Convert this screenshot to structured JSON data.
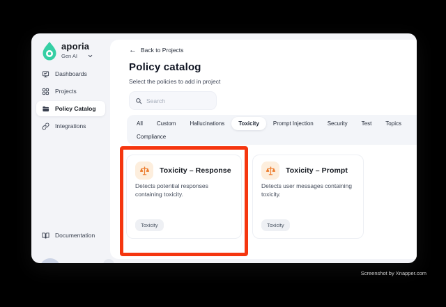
{
  "colors": {
    "accent-teal": "#35cfa4",
    "icon-orange": "#ec7c2e",
    "icon-orange-bg": "#fdeedd",
    "highlight-red": "#f5360f",
    "window-bg": "#f3f4f8"
  },
  "sidebar": {
    "logo": {
      "brand": "aporia",
      "workspace": "Gen AI",
      "chevron_icon": "chevron-down"
    },
    "items": [
      {
        "label": "Dashboards",
        "icon": "dashboard-icon",
        "active": false
      },
      {
        "label": "Projects",
        "icon": "projects-grid-icon",
        "active": false
      },
      {
        "label": "Policy Catalog",
        "icon": "folder-icon",
        "active": true
      },
      {
        "label": "Integrations",
        "icon": "link-icon",
        "active": false
      }
    ],
    "footer_item": {
      "label": "Documentation",
      "icon": "book-icon"
    }
  },
  "main": {
    "back_link": {
      "arrow": "←",
      "label": "Back to Projects"
    },
    "title": "Policy catalog",
    "subtitle": "Select the policies to add in project",
    "search": {
      "placeholder": "Search",
      "icon": "search-icon"
    },
    "tabs": [
      {
        "label": "All",
        "active": false
      },
      {
        "label": "Custom",
        "active": false
      },
      {
        "label": "Hallucinations",
        "active": false
      },
      {
        "label": "Toxicity",
        "active": true
      },
      {
        "label": "Prompt Injection",
        "active": false
      },
      {
        "label": "Security",
        "active": false
      },
      {
        "label": "Test",
        "active": false
      },
      {
        "label": "Topics",
        "active": false
      },
      {
        "label": "Compliance",
        "active": false
      }
    ],
    "cards": [
      {
        "title": "Toxicity – Response",
        "description": "Detects potential responses containing toxicity.",
        "tag": "Toxicity",
        "icon": "scales-icon",
        "highlighted": true
      },
      {
        "title": "Toxicity – Prompt",
        "description": "Detects user messages containing toxicity.",
        "tag": "Toxicity",
        "icon": "scales-icon",
        "highlighted": false
      }
    ]
  },
  "watermark": "Screenshot by Xnapper.com"
}
